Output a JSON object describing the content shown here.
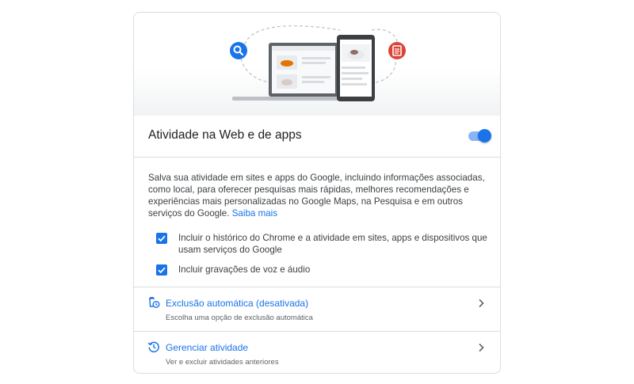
{
  "colors": {
    "accent": "#1a73e8",
    "icon_red": "#db4437",
    "divider": "#dadce0"
  },
  "header": {
    "title": "Atividade na Web e de apps",
    "toggle_on": true
  },
  "description": {
    "text": "Salva sua atividade em sites e apps do Google, incluindo informações associadas, como local, para oferecer pesquisas mais rápidas, melhores recomendações e experiências mais personalizadas no Google Maps, na Pesquisa e em outros serviços do Google.",
    "link": "Saiba mais"
  },
  "options": [
    {
      "label": "Incluir o histórico do Chrome e a atividade em sites, apps e dispositivos que usam serviços do Google",
      "checked": true
    },
    {
      "label": "Incluir gravações de voz e áudio",
      "checked": true
    }
  ],
  "rows": [
    {
      "title": "Exclusão automática (desativada)",
      "subtitle": "Escolha uma opção de exclusão automática",
      "icon": "auto-delete-icon"
    },
    {
      "title": "Gerenciar atividade",
      "subtitle": "Ver e excluir atividades anteriores",
      "icon": "history-icon"
    }
  ]
}
